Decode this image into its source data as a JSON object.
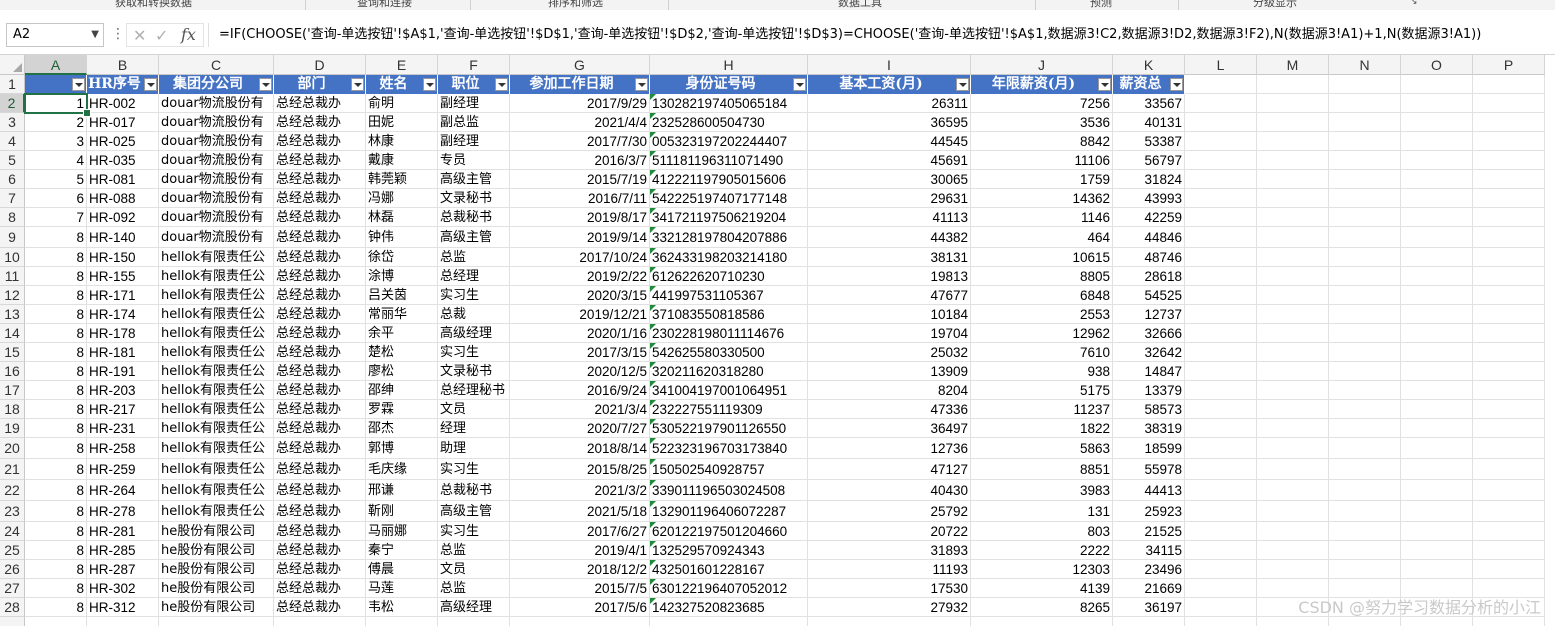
{
  "ribbon": {
    "groups": [
      "获取和转换数据",
      "查询和连接",
      "排序和筛选",
      "数据工具",
      "预测",
      "分级显示"
    ],
    "launcher_glyph": "↘"
  },
  "formula_bar": {
    "name_box": "A2",
    "cancel_glyph": "✕",
    "enter_glyph": "✓",
    "fx_label": "fx",
    "formula": "=IF(CHOOSE('查询-单选按钮'!$A$1,'查询-单选按钮'!$D$1,'查询-单选按钮'!$D$2,'查询-单选按钮'!$D$3)=CHOOSE('查询-单选按钮'!$A$1,数据源3!C2,数据源3!D2,数据源3!F2),N(数据源3!A1)+1,N(数据源3!A1))"
  },
  "sheet": {
    "columns": [
      "A",
      "B",
      "C",
      "D",
      "E",
      "F",
      "G",
      "H",
      "I",
      "J",
      "K",
      "L",
      "M",
      "N",
      "O",
      "P"
    ],
    "selected_column": "A",
    "selected_row": 2,
    "headers": [
      "",
      "HR序号",
      "集团分公司",
      "部门",
      "姓名",
      "职位",
      "参加工作日期",
      "身份证号码",
      "基本工资(月)",
      "年限薪资(月)",
      "薪资总"
    ],
    "rows": [
      {
        "n": 1,
        "hr": "HR-002",
        "company": "douar物流股份有",
        "dept": "总经总裁办",
        "name": "俞明",
        "pos": "副经理",
        "date": "2017/9/29",
        "id": "130282197405065184",
        "base": "26311",
        "tenure": "7256",
        "total": "33567"
      },
      {
        "n": 2,
        "hr": "HR-017",
        "company": "douar物流股份有",
        "dept": "总经总裁办",
        "name": "田妮",
        "pos": "副总监",
        "date": "2021/4/4",
        "id": "232528600504730",
        "base": "36595",
        "tenure": "3536",
        "total": "40131"
      },
      {
        "n": 3,
        "hr": "HR-025",
        "company": "douar物流股份有",
        "dept": "总经总裁办",
        "name": "林康",
        "pos": "副经理",
        "date": "2017/7/30",
        "id": "005323197202244407",
        "base": "44545",
        "tenure": "8842",
        "total": "53387"
      },
      {
        "n": 4,
        "hr": "HR-035",
        "company": "douar物流股份有",
        "dept": "总经总裁办",
        "name": "戴康",
        "pos": "专员",
        "date": "2016/3/7",
        "id": "511181196311071490",
        "base": "45691",
        "tenure": "11106",
        "total": "56797"
      },
      {
        "n": 5,
        "hr": "HR-081",
        "company": "douar物流股份有",
        "dept": "总经总裁办",
        "name": "韩莞颖",
        "pos": "高级主管",
        "date": "2015/7/19",
        "id": "412221197905015606",
        "base": "30065",
        "tenure": "1759",
        "total": "31824"
      },
      {
        "n": 6,
        "hr": "HR-088",
        "company": "douar物流股份有",
        "dept": "总经总裁办",
        "name": "冯娜",
        "pos": "文录秘书",
        "date": "2016/7/11",
        "id": "542225197407177148",
        "base": "29631",
        "tenure": "14362",
        "total": "43993"
      },
      {
        "n": 7,
        "hr": "HR-092",
        "company": "douar物流股份有",
        "dept": "总经总裁办",
        "name": "林磊",
        "pos": "总裁秘书",
        "date": "2019/8/17",
        "id": "341721197506219204",
        "base": "41113",
        "tenure": "1146",
        "total": "42259"
      },
      {
        "n": 8,
        "hr": "HR-140",
        "company": "douar物流股份有",
        "dept": "总经总裁办",
        "name": "钟伟",
        "pos": "高级主管",
        "date": "2019/9/14",
        "id": "332128197804207886",
        "base": "44382",
        "tenure": "464",
        "total": "44846"
      },
      {
        "n": 8,
        "hr": "HR-150",
        "company": "hellok有限责任公",
        "dept": "总经总裁办",
        "name": "徐岱",
        "pos": "总监",
        "date": "2017/10/24",
        "id": "362433198203214180",
        "base": "38131",
        "tenure": "10615",
        "total": "48746"
      },
      {
        "n": 8,
        "hr": "HR-155",
        "company": "hellok有限责任公",
        "dept": "总经总裁办",
        "name": "涂博",
        "pos": "总经理",
        "date": "2019/2/22",
        "id": "612622620710230",
        "base": "19813",
        "tenure": "8805",
        "total": "28618"
      },
      {
        "n": 8,
        "hr": "HR-171",
        "company": "hellok有限责任公",
        "dept": "总经总裁办",
        "name": "吕关茵",
        "pos": "实习生",
        "date": "2020/3/15",
        "id": "441997531105367",
        "base": "47677",
        "tenure": "6848",
        "total": "54525"
      },
      {
        "n": 8,
        "hr": "HR-174",
        "company": "hellok有限责任公",
        "dept": "总经总裁办",
        "name": "常丽华",
        "pos": "总裁",
        "date": "2019/12/21",
        "id": "371083550818586",
        "base": "10184",
        "tenure": "2553",
        "total": "12737"
      },
      {
        "n": 8,
        "hr": "HR-178",
        "company": "hellok有限责任公",
        "dept": "总经总裁办",
        "name": "余平",
        "pos": "高级经理",
        "date": "2020/1/16",
        "id": "230228198011114676",
        "base": "19704",
        "tenure": "12962",
        "total": "32666"
      },
      {
        "n": 8,
        "hr": "HR-181",
        "company": "hellok有限责任公",
        "dept": "总经总裁办",
        "name": "楚松",
        "pos": "实习生",
        "date": "2017/3/15",
        "id": "542625580330500",
        "base": "25032",
        "tenure": "7610",
        "total": "32642"
      },
      {
        "n": 8,
        "hr": "HR-191",
        "company": "hellok有限责任公",
        "dept": "总经总裁办",
        "name": "廖松",
        "pos": "文录秘书",
        "date": "2020/12/5",
        "id": "320211620318280",
        "base": "13909",
        "tenure": "938",
        "total": "14847"
      },
      {
        "n": 8,
        "hr": "HR-203",
        "company": "hellok有限责任公",
        "dept": "总经总裁办",
        "name": "邵绅",
        "pos": "总经理秘书",
        "date": "2016/9/24",
        "id": "341004197001064951",
        "base": "8204",
        "tenure": "5175",
        "total": "13379"
      },
      {
        "n": 8,
        "hr": "HR-217",
        "company": "hellok有限责任公",
        "dept": "总经总裁办",
        "name": "罗霖",
        "pos": "文员",
        "date": "2021/3/4",
        "id": "232227551119309",
        "base": "47336",
        "tenure": "11237",
        "total": "58573"
      },
      {
        "n": 8,
        "hr": "HR-231",
        "company": "hellok有限责任公",
        "dept": "总经总裁办",
        "name": "邵杰",
        "pos": "经理",
        "date": "2020/7/27",
        "id": "530522197901126550",
        "base": "36497",
        "tenure": "1822",
        "total": "38319"
      },
      {
        "n": 8,
        "hr": "HR-258",
        "company": "hellok有限责任公",
        "dept": "总经总裁办",
        "name": "郭博",
        "pos": "助理",
        "date": "2018/8/14",
        "id": "522323196703173840",
        "base": "12736",
        "tenure": "5863",
        "total": "18599"
      },
      {
        "n": 8,
        "hr": "HR-259",
        "company": "hellok有限责任公",
        "dept": "总经总裁办",
        "name": "毛庆缘",
        "pos": "实习生",
        "date": "2015/8/25",
        "id": "150502540928757",
        "base": "47127",
        "tenure": "8851",
        "total": "55978"
      },
      {
        "n": 8,
        "hr": "HR-264",
        "company": "hellok有限责任公",
        "dept": "总经总裁办",
        "name": "邢谦",
        "pos": "总裁秘书",
        "date": "2021/3/2",
        "id": "339011196503024508",
        "base": "40430",
        "tenure": "3983",
        "total": "44413"
      },
      {
        "n": 8,
        "hr": "HR-278",
        "company": "hellok有限责任公",
        "dept": "总经总裁办",
        "name": "靳刚",
        "pos": "高级主管",
        "date": "2021/5/18",
        "id": "132901196406072287",
        "base": "25792",
        "tenure": "131",
        "total": "25923"
      },
      {
        "n": 8,
        "hr": "HR-281",
        "company": "he股份有限公司",
        "dept": "总经总裁办",
        "name": "马丽娜",
        "pos": "实习生",
        "date": "2017/6/27",
        "id": "620122197501204660",
        "base": "20722",
        "tenure": "803",
        "total": "21525"
      },
      {
        "n": 8,
        "hr": "HR-285",
        "company": "he股份有限公司",
        "dept": "总经总裁办",
        "name": "秦宁",
        "pos": "总监",
        "date": "2019/4/1",
        "id": "132529570924343",
        "base": "31893",
        "tenure": "2222",
        "total": "34115"
      },
      {
        "n": 8,
        "hr": "HR-287",
        "company": "he股份有限公司",
        "dept": "总经总裁办",
        "name": "傅晨",
        "pos": "文员",
        "date": "2018/12/2",
        "id": "432501601228167",
        "base": "11193",
        "tenure": "12303",
        "total": "23496"
      },
      {
        "n": 8,
        "hr": "HR-302",
        "company": "he股份有限公司",
        "dept": "总经总裁办",
        "name": "马莲",
        "pos": "总监",
        "date": "2015/7/5",
        "id": "630122196407052012",
        "base": "17530",
        "tenure": "4139",
        "total": "21669"
      },
      {
        "n": 8,
        "hr": "HR-312",
        "company": "he股份有限公司",
        "dept": "总经总裁办",
        "name": "韦松",
        "pos": "高级经理",
        "date": "2017/5/6",
        "id": "142327520823685",
        "base": "27932",
        "tenure": "8265",
        "total": "36197"
      }
    ]
  },
  "watermark": "CSDN @努力学习数据分析的小江",
  "colors": {
    "header_fill": "#4472c4",
    "selection": "#217346",
    "header_text": "#ffffff"
  }
}
